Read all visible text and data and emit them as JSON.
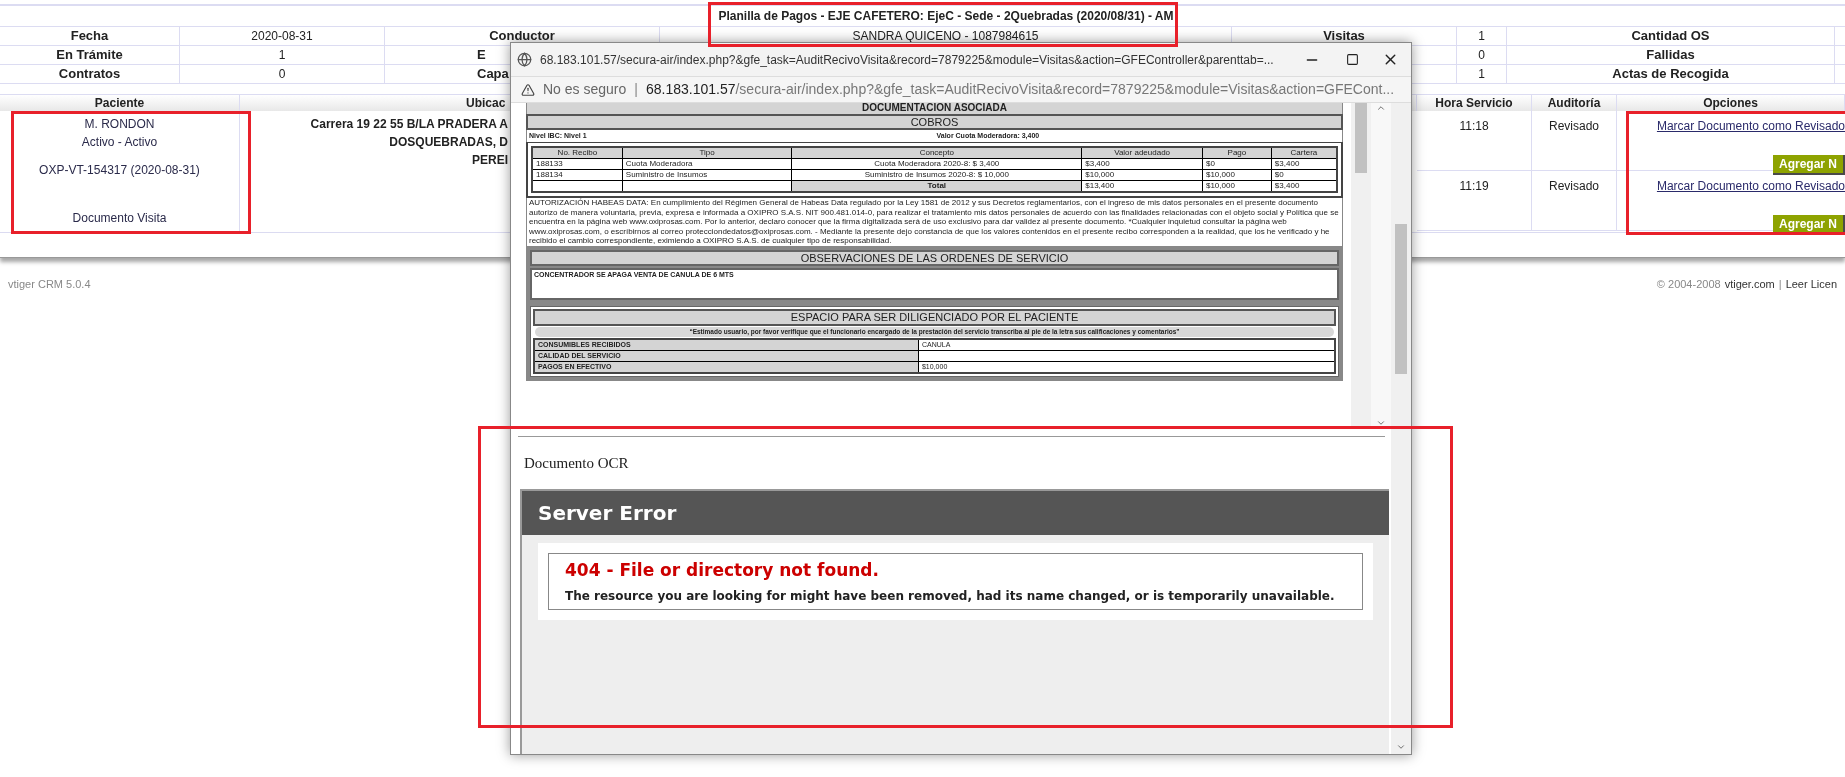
{
  "header": {
    "title": "Planilla de Pagos - EJE CAFETERO: EjeC - Sede - 2Quebradas (2020/08/31) - AM"
  },
  "summary_rows": [
    {
      "label_1": "Fecha",
      "value_1": "2020-08-31",
      "label_2": "Conductor",
      "value_2": "SANDRA QUICENO - 1087984615",
      "label_3": "Visitas",
      "value_3": "1",
      "label_4": "Cantidad OS"
    },
    {
      "label_1": "En Trámite",
      "value_1": "1",
      "label_2": "E",
      "value_3": "0",
      "label_4": "Fallidas"
    },
    {
      "label_1": "Contratos",
      "value_1": "0",
      "label_2": "Capa",
      "value_3": "1",
      "label_4": "Actas de Recogida"
    }
  ],
  "table": {
    "columns": [
      "Paciente",
      "Ubicac",
      "Hora Servicio",
      "Auditoría",
      "Opciones"
    ],
    "patient": {
      "name": "M. RONDON",
      "status": "Activo - Activo",
      "visit_id": "OXP-VT-154317 (2020-08-31)",
      "document_link": "Documento Visita"
    },
    "address_lines": [
      "Carrera 19 22 55 B/LA PRADERA A",
      "DOSQUEBRADAS, D",
      "PEREI"
    ],
    "visits": [
      {
        "time": "11:18",
        "audit": "Revisado",
        "link": "Marcar Documento como Revisado",
        "button": "Agregar N"
      },
      {
        "time": "11:19",
        "audit": "Revisado",
        "link": "Marcar Documento como Revisado",
        "button": "Agregar N"
      }
    ]
  },
  "footer": {
    "left": "vtiger CRM 5.0.4",
    "copyright": "© 2004-2008",
    "site_link": "vtiger.com",
    "separator": "|",
    "license_link": "Leer Licen"
  },
  "popup": {
    "title": "68.183.101.57/secura-air/index.php?&gfe_task=AuditRecivoVisita&record=7879225&module=Visitas&action=GFEController&parenttab=...",
    "security": "No es seguro",
    "address_separator": "|",
    "address_host": "68.183.101.57",
    "address_path": "/secura-air/index.php?&gfe_task=AuditRecivoVisita&record=7879225&module=Visitas&action=GFECont...",
    "document": {
      "title": "DOCUMENTACION ASOCIADA",
      "cobros_title": "COBROS",
      "info": [
        "Nivel IBC: Nivel 1",
        "Valor Cuota Moderadora: 3,400"
      ],
      "receipt_columns": [
        "No. Recibo",
        "Tipo",
        "Concepto",
        "Valor adeudado",
        "Pago",
        "Cartera"
      ],
      "receipts": [
        [
          "188133",
          "Cuota Moderadora",
          "Cuota Moderadora 2020-8: $ 3,400",
          "$3,400",
          "$0",
          "$3,400"
        ],
        [
          "188134",
          "Suministro de Insumos",
          "Suministro de Insumos 2020-8: $ 10,000",
          "$10,000",
          "$10,000",
          "$0"
        ]
      ],
      "total": {
        "label": "Total",
        "valor": "$13,400",
        "pago": "$10,000",
        "cartera": "$3,400"
      },
      "habeas": "AUTORIZACIÓN HABEAS DATA: En cumplimiento del Régimen General de Habeas Data regulado por la Ley 1581 de 2012 y sus Decretos reglamentarios, con el ingreso de mis datos personales en el presente documento autorizo de manera voluntaria, previa, expresa e informada a OXIPRO S.A.S. NIT 900.481.014-0, para realizar el tratamiento mis datos personales de acuerdo con las finalidades relacionadas con el objeto social y Política que se encuentra en la página web www.oxiprosas.com. Por lo anterior, declaro conocer que la firma digitalizada será de uso exclusivo para dar validez al presente documento. *Cualquier inquietud consultar la página web www.oxiprosas.com, o escríbirnos al correo protecciondedatos@oxiprosas.com. - Mediante la presente dejo constancia de que los valores contenidos en el presente recibo corresponden a la realidad, que los he verificado y he recibido el cambio correspondiente, eximiendo a OXIPRO S.A.S. de cualquier tipo de responsabilidad.",
      "observations_title": "OBSERVACIONES DE LAS ORDENES DE SERVICIO",
      "observations": "CONCENTRADOR SE APAGA VENTA DE CANULA DE 6 MTS",
      "patient_title": "ESPACIO PARA SER DILIGENCIADO POR EL PACIENTE",
      "patient_note": "“Estimado usuario, por favor verifique que el funcionario encargado de la prestación del servicio transcriba al pie de la letra sus calificaciones y comentarios”",
      "patient_rows": [
        {
          "label": "CONSUMIBLES RECIBIDOS",
          "value": "CANULA"
        },
        {
          "label": "CALIDAD DEL SERVICIO"
        },
        {
          "label": "PAGOS EN EFECTIVO",
          "value": "$10,000"
        }
      ]
    },
    "ocr_label": "Documento OCR",
    "error": {
      "title": "Server Error",
      "heading": "404 - File or directory not found.",
      "message": "The resource you are looking for might have been removed, had its name changed, or is temporarily unavailable."
    }
  }
}
